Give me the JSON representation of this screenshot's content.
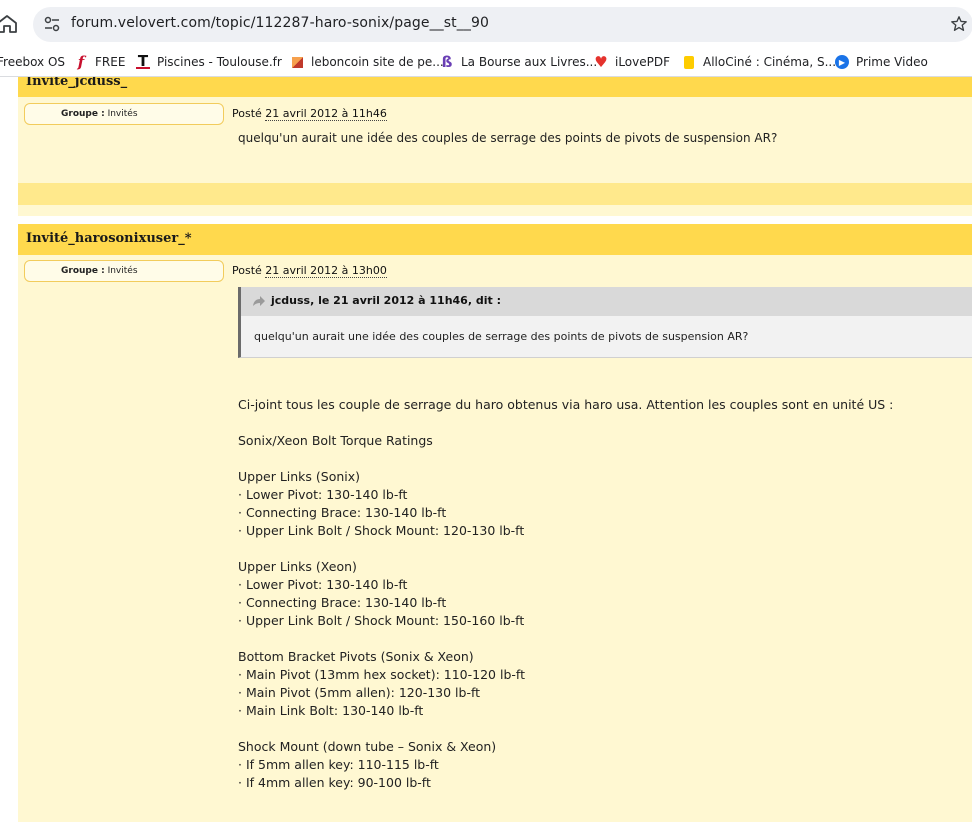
{
  "browser": {
    "url": "forum.velovert.com/topic/112287-haro-sonix/page__st__90",
    "bookmarks": [
      {
        "label": "Freebox OS",
        "icon": "freebox-icon"
      },
      {
        "label": "FREE",
        "icon": "free-logo-icon"
      },
      {
        "label": "Piscines - Toulouse.fr",
        "icon": "toulouse-logo-icon"
      },
      {
        "label": "leboncoin site de pe...",
        "icon": "leboncoin-icon"
      },
      {
        "label": "La Bourse aux Livres...",
        "icon": "bourse-livres-icon"
      },
      {
        "label": "iLovePDF",
        "icon": "heart-icon"
      },
      {
        "label": "AlloCiné : Cinéma, S...",
        "icon": "allocine-icon"
      },
      {
        "label": "Prime Video",
        "icon": "play-icon"
      }
    ]
  },
  "posts": [
    {
      "author": "Invité_jcduss_",
      "group_label": "Groupe :",
      "group_value": "Invités",
      "posted_label": "Posté",
      "date": "21 avril 2012 à 11h46",
      "body": "quelqu'un aurait une idée des couples de serrage des points de pivots de suspension AR?"
    },
    {
      "author": "Invité_harosonixuser_*",
      "group_label": "Groupe :",
      "group_value": "Invités",
      "posted_label": "Posté",
      "date": "21 avril 2012 à 13h00",
      "quote": {
        "title": "jcduss, le 21 avril 2012 à 11h46, dit :",
        "text": "quelqu'un aurait une idée des couples de serrage des points de pivots de suspension AR?"
      },
      "lines": [
        "Ci-joint tous les couple de serrage du haro obtenus via haro usa. Attention les couples sont en unité US :",
        "Sonix/Xeon Bolt Torque Ratings",
        "Upper Links (Sonix)",
        "· Lower Pivot: 130-140 lb-ft",
        "· Connecting Brace: 130-140 lb-ft",
        "· Upper Link Bolt / Shock Mount: 120-130 lb-ft",
        "Upper Links (Xeon)",
        "· Lower Pivot: 130-140 lb-ft",
        "· Connecting Brace: 130-140 lb-ft",
        "· Upper Link Bolt / Shock Mount: 150-160 lb-ft",
        "Bottom Bracket Pivots (Sonix & Xeon)",
        "· Main Pivot (13mm hex socket): 110-120 lb-ft",
        "· Main Pivot (5mm allen): 120-130 lb-ft",
        "· Main Link Bolt: 130-140 lb-ft",
        "Shock Mount (down tube – Sonix & Xeon)",
        "· If 5mm allen key: 110-115 lb-ft",
        "· If 4mm allen key: 90-100 lb-ft"
      ]
    }
  ]
}
